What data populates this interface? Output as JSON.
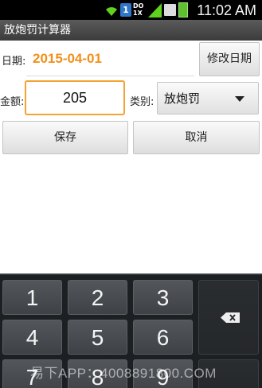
{
  "status_bar": {
    "time": "11:02 AM",
    "sim_label": "1",
    "network_label": "DO 1X"
  },
  "app": {
    "title": "放炮罚计算器"
  },
  "form": {
    "date_label": "日期:",
    "date_value": "2015-04-01",
    "change_date_button": "修改日期",
    "amount_label": "金额:",
    "amount_value": "205",
    "category_label": "类别:",
    "category_value": "放炮罚",
    "save_button": "保存",
    "cancel_button": "取消"
  },
  "keyboard": {
    "keys": [
      "1",
      "2",
      "3",
      "4",
      "5",
      "6",
      "7",
      "8",
      "9"
    ],
    "delete_icon": "backspace-icon"
  },
  "watermark": "易下APP：4008891800.COM"
}
